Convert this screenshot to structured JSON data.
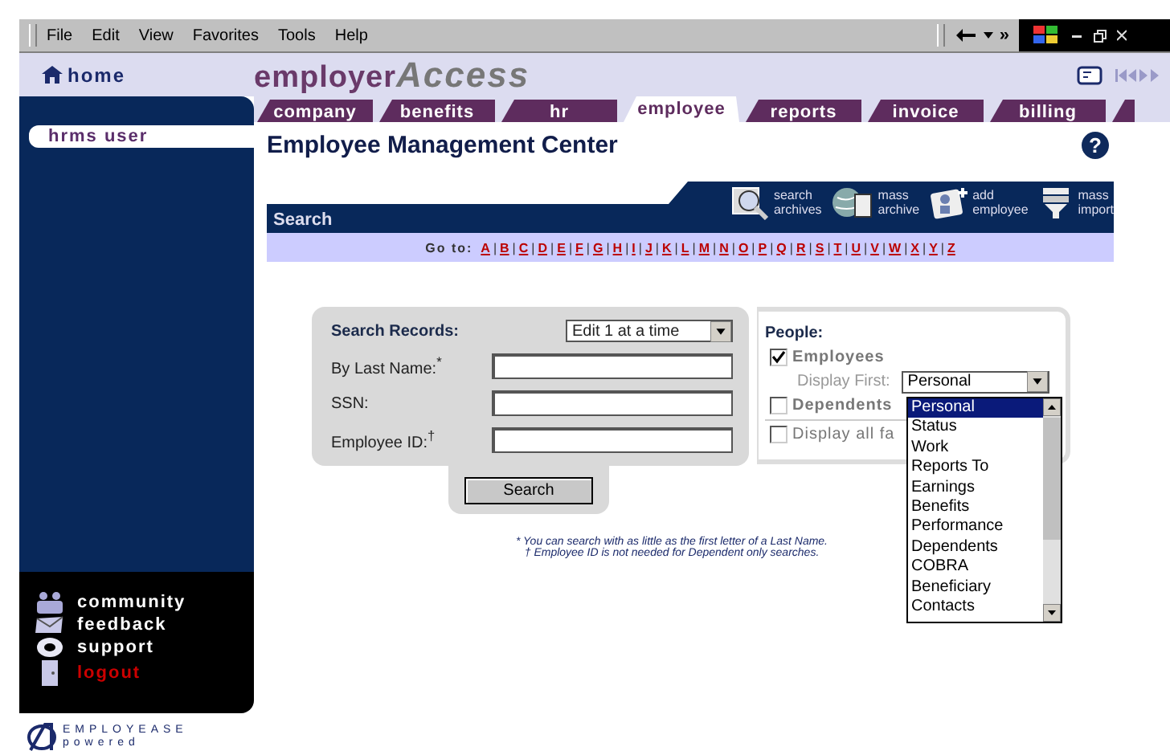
{
  "menu_bar": [
    "File",
    "Edit",
    "View",
    "Favorites",
    "Tools",
    "Help"
  ],
  "toolbar": {
    "more": "»"
  },
  "header": {
    "home": "home",
    "logo_a": "employer",
    "logo_b": "Access"
  },
  "tabs": [
    {
      "label": "company",
      "selected": false
    },
    {
      "label": "benefits",
      "selected": false
    },
    {
      "label": "hr",
      "selected": false
    },
    {
      "label": "employee",
      "selected": true
    },
    {
      "label": "reports",
      "selected": false
    },
    {
      "label": "invoice",
      "selected": false
    },
    {
      "label": "billing",
      "selected": false
    }
  ],
  "sidebar": {
    "user": "hrms user",
    "links": [
      {
        "label": "community",
        "kind": "people",
        "color": "#ffffff"
      },
      {
        "label": "feedback",
        "kind": "mail",
        "color": "#ffffff"
      },
      {
        "label": "support",
        "kind": "buoy",
        "color": "#ffffff"
      },
      {
        "label": "logout",
        "kind": "door",
        "color": "#cc0000"
      }
    ],
    "powered": {
      "brand_a": "EMPLOYEASE",
      "brand_b": "powered"
    }
  },
  "page_title": "Employee Management Center",
  "help": "?",
  "search_bar": {
    "title": "Search",
    "actions": [
      {
        "kind": "archives",
        "lines": [
          "search",
          "archives"
        ]
      },
      {
        "kind": "globe",
        "lines": [
          "mass",
          "archive"
        ]
      },
      {
        "kind": "add",
        "lines": [
          "add",
          "employee"
        ]
      },
      {
        "kind": "import",
        "lines": [
          "mass",
          "import"
        ]
      }
    ]
  },
  "goto": {
    "label": "Go to:",
    "separator": "|",
    "letters": [
      "A",
      "B",
      "C",
      "D",
      "E",
      "F",
      "G",
      "H",
      "I",
      "J",
      "K",
      "L",
      "M",
      "N",
      "O",
      "P",
      "Q",
      "R",
      "S",
      "T",
      "U",
      "V",
      "W",
      "X",
      "Y",
      "Z"
    ]
  },
  "form": {
    "title": "Search Records:",
    "mode": "Edit 1 at a time",
    "fields": [
      {
        "label": "By Last Name:$^{*}$"
      },
      {
        "label": "SSN:"
      },
      {
        "label": "Employee ID:$^{†}$"
      }
    ],
    "button": "Search"
  },
  "people": {
    "title": "People:",
    "options": [
      {
        "kind": "checkbox",
        "label": "Employees",
        "checked": true
      },
      {
        "kind": "select",
        "label": "Display First:",
        "value": "Personal"
      },
      {
        "kind": "checkbox",
        "label": "Dependents",
        "checked": false
      },
      {
        "kind": "checkbox",
        "label": "Display all fa",
        "checked": false
      }
    ]
  },
  "dropdown": [
    {
      "label": "Personal",
      "selected": true
    },
    {
      "label": "Status",
      "selected": false
    },
    {
      "label": "Work",
      "selected": false
    },
    {
      "label": "Reports To",
      "selected": false
    },
    {
      "label": "Earnings",
      "selected": false
    },
    {
      "label": "Benefits",
      "selected": false
    },
    {
      "label": "Performance",
      "selected": false
    },
    {
      "label": "Dependents",
      "selected": false
    },
    {
      "label": "COBRA",
      "selected": false
    },
    {
      "label": "Beneficiary",
      "selected": false
    },
    {
      "label": "Contacts",
      "selected": false
    }
  ],
  "notes": [
    "* You can search with as little as the first letter of a Last Name.",
    "† Employee ID is not needed for Dependent only searches."
  ]
}
